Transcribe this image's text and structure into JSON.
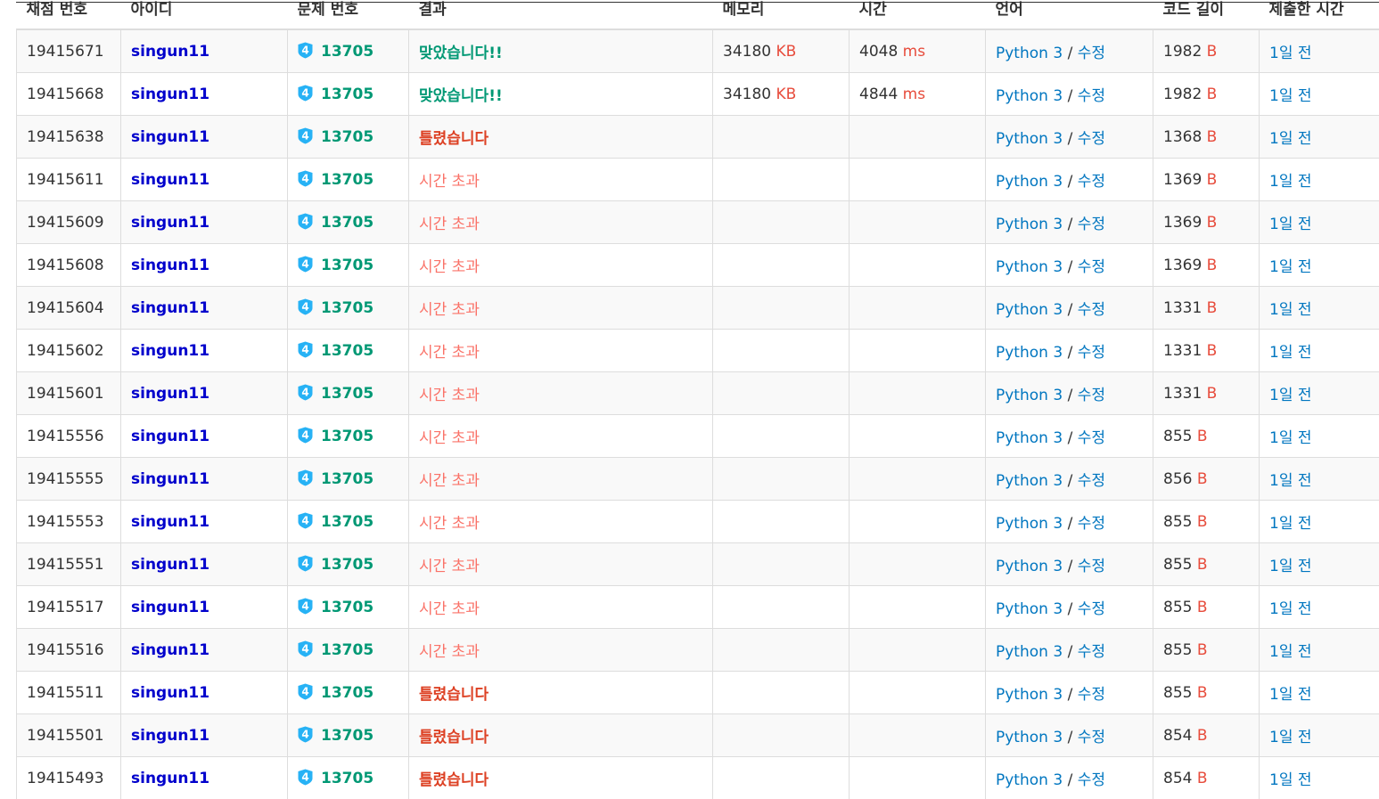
{
  "table": {
    "headers": [
      "채점 번호",
      "아이디",
      "문제 번호",
      "결과",
      "메모리",
      "시간",
      "언어",
      "코드 길이",
      "제출한 시간"
    ],
    "tier_badge_label": "4",
    "rows": [
      {
        "id": "19415671",
        "user": "singun11",
        "problem": "13705",
        "result": "맞았습니다!!",
        "result_type": "ok",
        "memory": "34180",
        "memory_unit": "KB",
        "time": "4048",
        "time_unit": "ms",
        "lang": "Python 3",
        "edit": "수정",
        "sep": "/",
        "code_len": "1982",
        "code_unit": "B",
        "submitted": "1일 전"
      },
      {
        "id": "19415668",
        "user": "singun11",
        "problem": "13705",
        "result": "맞았습니다!!",
        "result_type": "ok",
        "memory": "34180",
        "memory_unit": "KB",
        "time": "4844",
        "time_unit": "ms",
        "lang": "Python 3",
        "edit": "수정",
        "sep": "/",
        "code_len": "1982",
        "code_unit": "B",
        "submitted": "1일 전"
      },
      {
        "id": "19415638",
        "user": "singun11",
        "problem": "13705",
        "result": "틀렸습니다",
        "result_type": "wa",
        "memory": "",
        "memory_unit": "",
        "time": "",
        "time_unit": "",
        "lang": "Python 3",
        "edit": "수정",
        "sep": "/",
        "code_len": "1368",
        "code_unit": "B",
        "submitted": "1일 전"
      },
      {
        "id": "19415611",
        "user": "singun11",
        "problem": "13705",
        "result": "시간 초과",
        "result_type": "tle",
        "memory": "",
        "memory_unit": "",
        "time": "",
        "time_unit": "",
        "lang": "Python 3",
        "edit": "수정",
        "sep": "/",
        "code_len": "1369",
        "code_unit": "B",
        "submitted": "1일 전"
      },
      {
        "id": "19415609",
        "user": "singun11",
        "problem": "13705",
        "result": "시간 초과",
        "result_type": "tle",
        "memory": "",
        "memory_unit": "",
        "time": "",
        "time_unit": "",
        "lang": "Python 3",
        "edit": "수정",
        "sep": "/",
        "code_len": "1369",
        "code_unit": "B",
        "submitted": "1일 전"
      },
      {
        "id": "19415608",
        "user": "singun11",
        "problem": "13705",
        "result": "시간 초과",
        "result_type": "tle",
        "memory": "",
        "memory_unit": "",
        "time": "",
        "time_unit": "",
        "lang": "Python 3",
        "edit": "수정",
        "sep": "/",
        "code_len": "1369",
        "code_unit": "B",
        "submitted": "1일 전"
      },
      {
        "id": "19415604",
        "user": "singun11",
        "problem": "13705",
        "result": "시간 초과",
        "result_type": "tle",
        "memory": "",
        "memory_unit": "",
        "time": "",
        "time_unit": "",
        "lang": "Python 3",
        "edit": "수정",
        "sep": "/",
        "code_len": "1331",
        "code_unit": "B",
        "submitted": "1일 전"
      },
      {
        "id": "19415602",
        "user": "singun11",
        "problem": "13705",
        "result": "시간 초과",
        "result_type": "tle",
        "memory": "",
        "memory_unit": "",
        "time": "",
        "time_unit": "",
        "lang": "Python 3",
        "edit": "수정",
        "sep": "/",
        "code_len": "1331",
        "code_unit": "B",
        "submitted": "1일 전"
      },
      {
        "id": "19415601",
        "user": "singun11",
        "problem": "13705",
        "result": "시간 초과",
        "result_type": "tle",
        "memory": "",
        "memory_unit": "",
        "time": "",
        "time_unit": "",
        "lang": "Python 3",
        "edit": "수정",
        "sep": "/",
        "code_len": "1331",
        "code_unit": "B",
        "submitted": "1일 전"
      },
      {
        "id": "19415556",
        "user": "singun11",
        "problem": "13705",
        "result": "시간 초과",
        "result_type": "tle",
        "memory": "",
        "memory_unit": "",
        "time": "",
        "time_unit": "",
        "lang": "Python 3",
        "edit": "수정",
        "sep": "/",
        "code_len": "855",
        "code_unit": "B",
        "submitted": "1일 전"
      },
      {
        "id": "19415555",
        "user": "singun11",
        "problem": "13705",
        "result": "시간 초과",
        "result_type": "tle",
        "memory": "",
        "memory_unit": "",
        "time": "",
        "time_unit": "",
        "lang": "Python 3",
        "edit": "수정",
        "sep": "/",
        "code_len": "856",
        "code_unit": "B",
        "submitted": "1일 전"
      },
      {
        "id": "19415553",
        "user": "singun11",
        "problem": "13705",
        "result": "시간 초과",
        "result_type": "tle",
        "memory": "",
        "memory_unit": "",
        "time": "",
        "time_unit": "",
        "lang": "Python 3",
        "edit": "수정",
        "sep": "/",
        "code_len": "855",
        "code_unit": "B",
        "submitted": "1일 전"
      },
      {
        "id": "19415551",
        "user": "singun11",
        "problem": "13705",
        "result": "시간 초과",
        "result_type": "tle",
        "memory": "",
        "memory_unit": "",
        "time": "",
        "time_unit": "",
        "lang": "Python 3",
        "edit": "수정",
        "sep": "/",
        "code_len": "855",
        "code_unit": "B",
        "submitted": "1일 전"
      },
      {
        "id": "19415517",
        "user": "singun11",
        "problem": "13705",
        "result": "시간 초과",
        "result_type": "tle",
        "memory": "",
        "memory_unit": "",
        "time": "",
        "time_unit": "",
        "lang": "Python 3",
        "edit": "수정",
        "sep": "/",
        "code_len": "855",
        "code_unit": "B",
        "submitted": "1일 전"
      },
      {
        "id": "19415516",
        "user": "singun11",
        "problem": "13705",
        "result": "시간 초과",
        "result_type": "tle",
        "memory": "",
        "memory_unit": "",
        "time": "",
        "time_unit": "",
        "lang": "Python 3",
        "edit": "수정",
        "sep": "/",
        "code_len": "855",
        "code_unit": "B",
        "submitted": "1일 전"
      },
      {
        "id": "19415511",
        "user": "singun11",
        "problem": "13705",
        "result": "틀렸습니다",
        "result_type": "wa",
        "memory": "",
        "memory_unit": "",
        "time": "",
        "time_unit": "",
        "lang": "Python 3",
        "edit": "수정",
        "sep": "/",
        "code_len": "855",
        "code_unit": "B",
        "submitted": "1일 전"
      },
      {
        "id": "19415501",
        "user": "singun11",
        "problem": "13705",
        "result": "틀렸습니다",
        "result_type": "wa",
        "memory": "",
        "memory_unit": "",
        "time": "",
        "time_unit": "",
        "lang": "Python 3",
        "edit": "수정",
        "sep": "/",
        "code_len": "854",
        "code_unit": "B",
        "submitted": "1일 전"
      },
      {
        "id": "19415493",
        "user": "singun11",
        "problem": "13705",
        "result": "틀렸습니다",
        "result_type": "wa",
        "memory": "",
        "memory_unit": "",
        "time": "",
        "time_unit": "",
        "lang": "Python 3",
        "edit": "수정",
        "sep": "/",
        "code_len": "854",
        "code_unit": "B",
        "submitted": "1일 전"
      }
    ]
  },
  "colors": {
    "user_link": "#0000cc",
    "problem_link": "#009874",
    "accepted": "#009874",
    "wrong_answer": "#dd4124",
    "time_limit": "#fa7268",
    "unit": "#e74c3c",
    "link": "#0076c0",
    "tier_badge": "#27b2f5"
  },
  "icons": {
    "tier_badge": "solvedac-silver-4-tier-icon"
  }
}
